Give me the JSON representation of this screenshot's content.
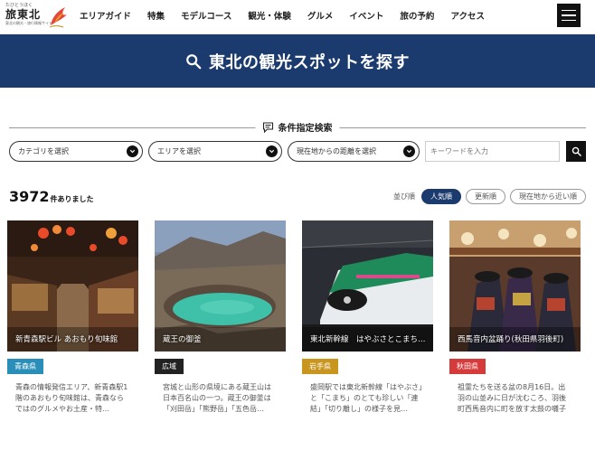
{
  "logo": {
    "kana": "たびとうほく",
    "main": "旅東北",
    "sub": "東北の観光・旅行情報サイト"
  },
  "nav": [
    "エリアガイド",
    "特集",
    "モデルコース",
    "観光・体験",
    "グルメ",
    "イベント",
    "旅の予約",
    "アクセス"
  ],
  "hero": {
    "title": "東北の観光スポットを探す"
  },
  "filter": {
    "title": "条件指定検索",
    "category": "カテゴリを選択",
    "area": "エリアを選択",
    "distance": "現在地からの距離を選択",
    "keyword_placeholder": "キーワードを入力"
  },
  "results": {
    "count": "3972",
    "count_suffix": "件ありました",
    "sort_label": "並び順",
    "sort_options": [
      "人気順",
      "更新順",
      "現在地から近い順"
    ],
    "active_sort": "人気順"
  },
  "cards": [
    {
      "caption": "新青森駅ビル あおもり旬味館",
      "tag": "青森県",
      "tag_color": "#2a8fb8",
      "desc": "青森の情報発信エリア、新青森駅1階のあおもり旬味館は、青森ならではのグルメやお土産・特…"
    },
    {
      "caption": "蔵王の御釜",
      "tag": "広域",
      "tag_color": "#222222",
      "desc": "宮城と山形の県境にある蔵王山は日本百名山の一つ。蔵王の御釜は「刈田岳」「熊野岳」「五色岳…"
    },
    {
      "caption": "東北新幹線　はやぶさとこまち…",
      "tag": "岩手県",
      "tag_color": "#c8951e",
      "desc": "盛岡駅では東北新幹線「はやぶさ」と「こまち」のとても珍しい「連結」「切り離し」の様子を見…"
    },
    {
      "caption": "西馬音内盆踊り(秋田県羽後町)",
      "tag": "秋田県",
      "tag_color": "#d63b3b",
      "desc": "祖霊たちを送る盆の8月16日。出羽の山並みに日が沈むころ、羽後町西馬音内に町を放す太鼓の囃子が…"
    }
  ]
}
